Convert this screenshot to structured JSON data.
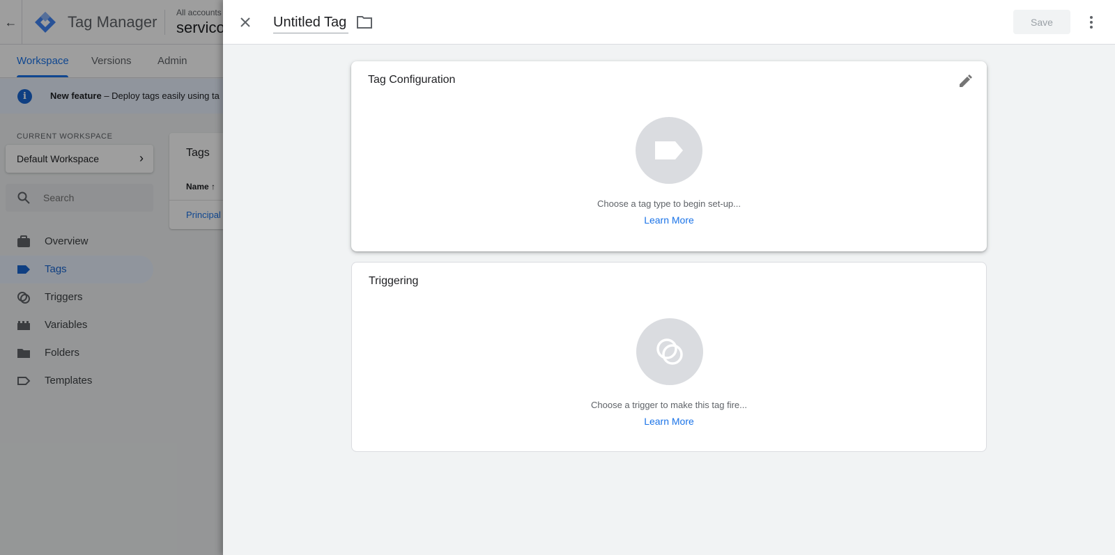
{
  "app": {
    "title": "Tag Manager",
    "account_small": "All accounts",
    "account_big": "servico"
  },
  "nav_tabs": [
    {
      "label": "Workspace"
    },
    {
      "label": "Versions"
    },
    {
      "label": "Admin"
    }
  ],
  "banner": {
    "bold": "New feature",
    "text": " –  Deploy tags easily using ta"
  },
  "sidebar": {
    "current_workspace_label": "CURRENT WORKSPACE",
    "workspace_name": "Default Workspace",
    "search_placeholder": "Search",
    "items": [
      {
        "label": "Overview",
        "icon": "briefcase-icon"
      },
      {
        "label": "Tags",
        "icon": "tag-icon"
      },
      {
        "label": "Triggers",
        "icon": "trigger-icon"
      },
      {
        "label": "Variables",
        "icon": "variables-icon"
      },
      {
        "label": "Folders",
        "icon": "folder-icon"
      },
      {
        "label": "Templates",
        "icon": "template-icon"
      }
    ]
  },
  "tags_list": {
    "title": "Tags",
    "name_header": "Name ↑",
    "row": "Principal"
  },
  "drawer": {
    "tag_name": "Untitled Tag",
    "save_label": "Save",
    "tag_config": {
      "title": "Tag Configuration",
      "hint": "Choose a tag type to begin set-up...",
      "learn_more": "Learn More"
    },
    "triggering": {
      "title": "Triggering",
      "hint": "Choose a trigger to make this tag fire...",
      "learn_more": "Learn More"
    }
  },
  "colors": {
    "accent": "#1a73e8",
    "placeholder_circle": "#dadce0"
  }
}
